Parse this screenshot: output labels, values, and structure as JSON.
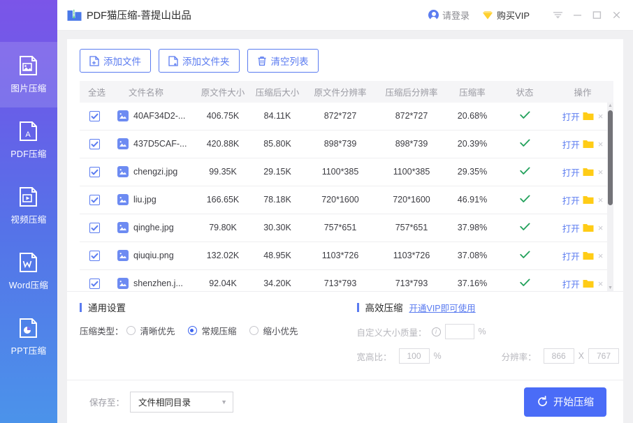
{
  "app": {
    "title": "PDF猫压缩-菩提山出品",
    "icon": "zip-folder-icon"
  },
  "titlebar": {
    "login_label": "请登录",
    "vip_label": "购买VIP",
    "menu_icon": "menu-icon",
    "minimize_icon": "minimize-icon",
    "maximize_icon": "maximize-icon",
    "close_icon": "close-icon"
  },
  "sidebar": {
    "items": [
      {
        "label": "图片压缩",
        "icon": "image-compress-icon",
        "active": true
      },
      {
        "label": "PDF压缩",
        "icon": "pdf-compress-icon",
        "active": false
      },
      {
        "label": "视频压缩",
        "icon": "video-compress-icon",
        "active": false
      },
      {
        "label": "Word压缩",
        "icon": "word-compress-icon",
        "active": false
      },
      {
        "label": "PPT压缩",
        "icon": "ppt-compress-icon",
        "active": false
      }
    ]
  },
  "toolbar": {
    "add_file_label": "添加文件",
    "add_folder_label": "添加文件夹",
    "clear_list_label": "清空列表"
  },
  "table": {
    "headers": {
      "select": "全选",
      "name": "文件名称",
      "orig_size": "原文件大小",
      "comp_size": "压缩后大小",
      "orig_res": "原文件分辨率",
      "comp_res": "压缩后分辨率",
      "rate": "压缩率",
      "state": "状态",
      "action": "操作"
    },
    "open_label": "打开",
    "rows": [
      {
        "checked": true,
        "name": "40AF34D2-...",
        "orig_size": "406.75K",
        "comp_size": "84.11K",
        "orig_res": "872*727",
        "comp_res": "872*727",
        "rate": "20.68%",
        "state": "done"
      },
      {
        "checked": true,
        "name": "437D5CAF-...",
        "orig_size": "420.88K",
        "comp_size": "85.80K",
        "orig_res": "898*739",
        "comp_res": "898*739",
        "rate": "20.39%",
        "state": "done"
      },
      {
        "checked": true,
        "name": "chengzi.jpg",
        "orig_size": "99.35K",
        "comp_size": "29.15K",
        "orig_res": "1100*385",
        "comp_res": "1100*385",
        "rate": "29.35%",
        "state": "done"
      },
      {
        "checked": true,
        "name": "liu.jpg",
        "orig_size": "166.65K",
        "comp_size": "78.18K",
        "orig_res": "720*1600",
        "comp_res": "720*1600",
        "rate": "46.91%",
        "state": "done"
      },
      {
        "checked": true,
        "name": "qinghe.jpg",
        "orig_size": "79.80K",
        "comp_size": "30.30K",
        "orig_res": "757*651",
        "comp_res": "757*651",
        "rate": "37.98%",
        "state": "done"
      },
      {
        "checked": true,
        "name": "qiuqiu.png",
        "orig_size": "132.02K",
        "comp_size": "48.95K",
        "orig_res": "1103*726",
        "comp_res": "1103*726",
        "rate": "37.08%",
        "state": "done"
      },
      {
        "checked": true,
        "name": "shenzhen.j...",
        "orig_size": "92.04K",
        "comp_size": "34.20K",
        "orig_res": "713*793",
        "comp_res": "713*793",
        "rate": "37.16%",
        "state": "done"
      }
    ]
  },
  "general_settings": {
    "title": "通用设置",
    "type_label": "压缩类型：",
    "options": [
      {
        "label": "清晰优先",
        "selected": false
      },
      {
        "label": "常规压缩",
        "selected": true
      },
      {
        "label": "缩小优先",
        "selected": false
      }
    ]
  },
  "advanced_settings": {
    "title": "高效压缩",
    "vip_link": "开通VIP即可使用",
    "quality_label": "自定义大小质量：",
    "quality_value": "",
    "quality_unit": "%",
    "ratio_label": "宽高比：",
    "ratio_value": "100",
    "ratio_unit": "%",
    "resolution_label": "分辨率：",
    "resolution_width": "866",
    "resolution_sep": "X",
    "resolution_height": "767"
  },
  "footer": {
    "save_to_label": "保存至：",
    "save_to_value": "文件相同目录",
    "start_label": "开始压缩"
  },
  "colors": {
    "accent": "#5a7bf0",
    "primary_button": "#4a6cf7",
    "success": "#22a15b",
    "vip_yellow": "#ffd02e",
    "sidebar_top": "#7b55e8",
    "sidebar_bottom": "#4b93ea"
  }
}
